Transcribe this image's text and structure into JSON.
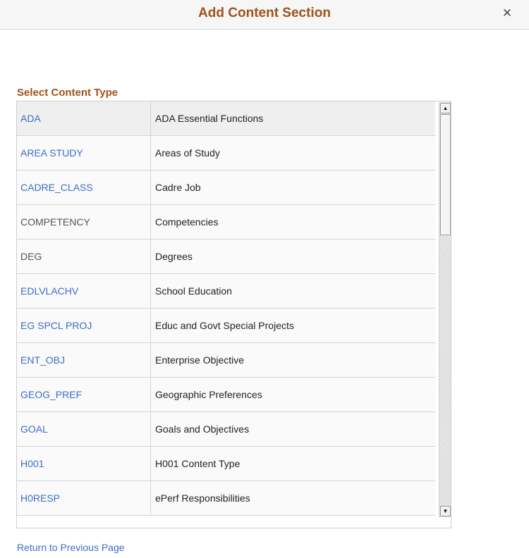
{
  "dialog": {
    "title": "Add Content Section",
    "close_glyph": "✕"
  },
  "section_label": "Select Content Type",
  "rows": [
    {
      "code": "ADA",
      "description": "ADA Essential Functions",
      "link": true
    },
    {
      "code": "AREA STUDY",
      "description": "Areas of Study",
      "link": true
    },
    {
      "code": "CADRE_CLASS",
      "description": "Cadre Job",
      "link": true
    },
    {
      "code": "COMPETENCY",
      "description": "Competencies",
      "link": false
    },
    {
      "code": "DEG",
      "description": "Degrees",
      "link": false
    },
    {
      "code": "EDLVLACHV",
      "description": "School Education",
      "link": true
    },
    {
      "code": "EG SPCL PROJ",
      "description": "Educ and Govt Special Projects",
      "link": true
    },
    {
      "code": "ENT_OBJ",
      "description": "Enterprise Objective",
      "link": true
    },
    {
      "code": "GEOG_PREF",
      "description": "Geographic Preferences",
      "link": true
    },
    {
      "code": "GOAL",
      "description": "Goals and Objectives",
      "link": true
    },
    {
      "code": "H001",
      "description": "H001 Content Type",
      "link": true
    },
    {
      "code": "H0RESP",
      "description": "ePerf Responsibilities",
      "link": true
    }
  ],
  "scrollbar": {
    "up_glyph": "▲",
    "down_glyph": "▼"
  },
  "footer": {
    "return_label": "Return to Previous Page"
  },
  "colors": {
    "title": "#a0511c",
    "link": "#3c6dc3"
  }
}
